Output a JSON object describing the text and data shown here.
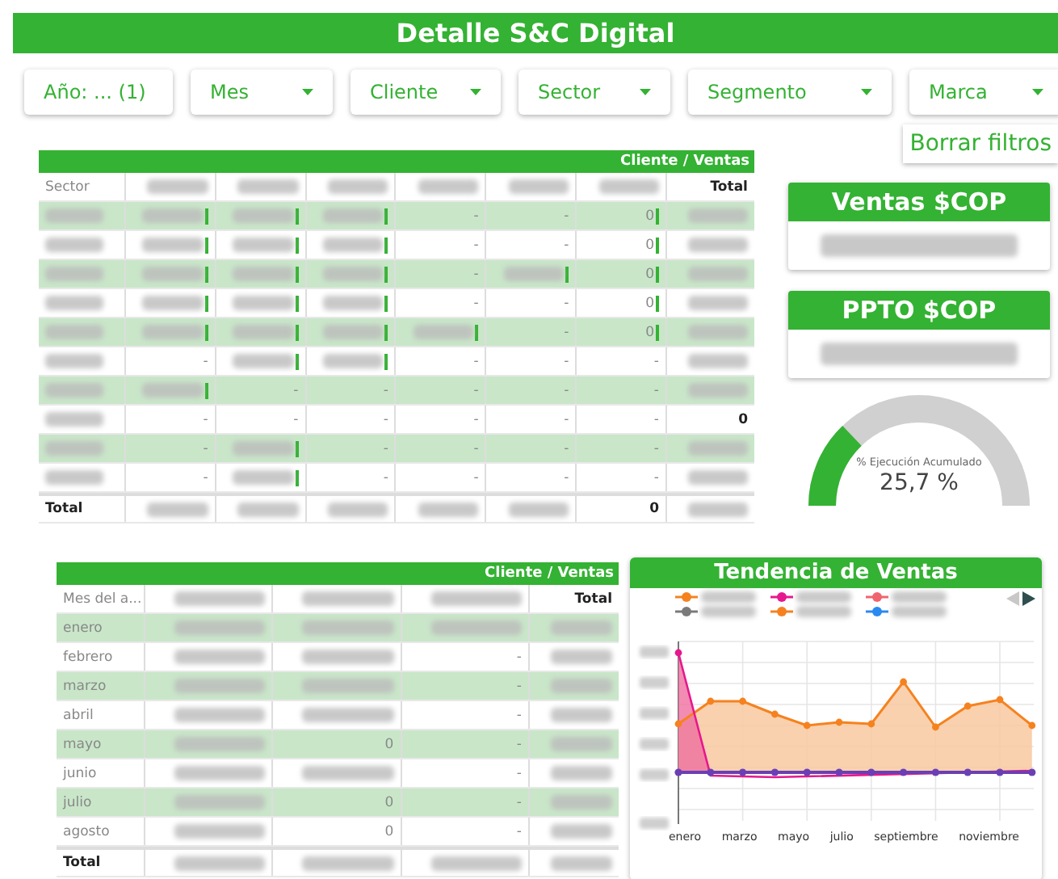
{
  "title": "Detalle S&C Digital",
  "filters": [
    {
      "label": "Año: ... (1)"
    },
    {
      "label": "Mes"
    },
    {
      "label": "Cliente"
    },
    {
      "label": "Sector"
    },
    {
      "label": "Segmento"
    },
    {
      "label": "Marca"
    }
  ],
  "clear_button": "Borrar filtros",
  "sector_table": {
    "banner": "Cliente / Ventas",
    "header": [
      {
        "kind": "text",
        "text": "Sector"
      },
      {
        "kind": "blurred"
      },
      {
        "kind": "blurred"
      },
      {
        "kind": "blurred"
      },
      {
        "kind": "blurred"
      },
      {
        "kind": "blurred"
      },
      {
        "kind": "blurred"
      },
      {
        "kind": "text",
        "text": "Total"
      }
    ],
    "rows": [
      [
        {
          "kind": "blurred"
        },
        {
          "kind": "blurred",
          "bar": true
        },
        {
          "kind": "blurred",
          "bar": true
        },
        {
          "kind": "blurred",
          "bar": true
        },
        {
          "kind": "text",
          "text": "-"
        },
        {
          "kind": "text",
          "text": "-"
        },
        {
          "kind": "text",
          "text": "0",
          "bar": true
        },
        {
          "kind": "blurred"
        }
      ],
      [
        {
          "kind": "blurred"
        },
        {
          "kind": "blurred",
          "bar": true
        },
        {
          "kind": "blurred",
          "bar": true
        },
        {
          "kind": "blurred",
          "bar": true
        },
        {
          "kind": "text",
          "text": "-"
        },
        {
          "kind": "text",
          "text": "-"
        },
        {
          "kind": "text",
          "text": "0",
          "bar": true
        },
        {
          "kind": "blurred"
        }
      ],
      [
        {
          "kind": "blurred"
        },
        {
          "kind": "blurred",
          "bar": true
        },
        {
          "kind": "blurred",
          "bar": true
        },
        {
          "kind": "blurred",
          "bar": true
        },
        {
          "kind": "text",
          "text": "-"
        },
        {
          "kind": "blurred",
          "bar": true
        },
        {
          "kind": "text",
          "text": "0",
          "bar": true
        },
        {
          "kind": "blurred"
        }
      ],
      [
        {
          "kind": "blurred"
        },
        {
          "kind": "blurred",
          "bar": true
        },
        {
          "kind": "blurred",
          "bar": true
        },
        {
          "kind": "blurred",
          "bar": true
        },
        {
          "kind": "text",
          "text": "-"
        },
        {
          "kind": "text",
          "text": "-"
        },
        {
          "kind": "text",
          "text": "0",
          "bar": true
        },
        {
          "kind": "blurred"
        }
      ],
      [
        {
          "kind": "blurred"
        },
        {
          "kind": "blurred",
          "bar": true
        },
        {
          "kind": "blurred",
          "bar": true
        },
        {
          "kind": "blurred",
          "bar": true
        },
        {
          "kind": "blurred",
          "bar": true
        },
        {
          "kind": "text",
          "text": "-"
        },
        {
          "kind": "text",
          "text": "0",
          "bar": true
        },
        {
          "kind": "blurred"
        }
      ],
      [
        {
          "kind": "blurred"
        },
        {
          "kind": "text",
          "text": "-"
        },
        {
          "kind": "blurred",
          "bar": true
        },
        {
          "kind": "blurred",
          "bar": true
        },
        {
          "kind": "text",
          "text": "-"
        },
        {
          "kind": "text",
          "text": "-"
        },
        {
          "kind": "text",
          "text": "-"
        },
        {
          "kind": "blurred"
        }
      ],
      [
        {
          "kind": "blurred"
        },
        {
          "kind": "blurred",
          "bar": true
        },
        {
          "kind": "text",
          "text": "-"
        },
        {
          "kind": "text",
          "text": "-"
        },
        {
          "kind": "text",
          "text": "-"
        },
        {
          "kind": "text",
          "text": "-"
        },
        {
          "kind": "text",
          "text": "-"
        },
        {
          "kind": "blurred"
        }
      ],
      [
        {
          "kind": "blurred"
        },
        {
          "kind": "text",
          "text": "-"
        },
        {
          "kind": "text",
          "text": "-"
        },
        {
          "kind": "text",
          "text": "-"
        },
        {
          "kind": "text",
          "text": "-"
        },
        {
          "kind": "text",
          "text": "-"
        },
        {
          "kind": "text",
          "text": "-"
        },
        {
          "kind": "text",
          "text": "0"
        }
      ],
      [
        {
          "kind": "blurred"
        },
        {
          "kind": "text",
          "text": "-"
        },
        {
          "kind": "blurred",
          "bar": true
        },
        {
          "kind": "text",
          "text": "-"
        },
        {
          "kind": "text",
          "text": "-"
        },
        {
          "kind": "text",
          "text": "-"
        },
        {
          "kind": "text",
          "text": "-"
        },
        {
          "kind": "blurred"
        }
      ],
      [
        {
          "kind": "blurred"
        },
        {
          "kind": "text",
          "text": "-"
        },
        {
          "kind": "blurred",
          "bar": true
        },
        {
          "kind": "text",
          "text": "-"
        },
        {
          "kind": "text",
          "text": "-"
        },
        {
          "kind": "text",
          "text": "-"
        },
        {
          "kind": "text",
          "text": "-"
        },
        {
          "kind": "blurred"
        }
      ]
    ],
    "total_row": [
      {
        "kind": "text",
        "text": "Total"
      },
      {
        "kind": "blurred"
      },
      {
        "kind": "blurred"
      },
      {
        "kind": "blurred"
      },
      {
        "kind": "blurred"
      },
      {
        "kind": "blurred"
      },
      {
        "kind": "text",
        "text": "0"
      },
      {
        "kind": "blurred"
      }
    ]
  },
  "kpis": [
    {
      "title": "Ventas $COP",
      "value": {
        "kind": "blurred"
      }
    },
    {
      "title": "PPTO $COP",
      "value": {
        "kind": "blurred"
      }
    }
  ],
  "gauge": {
    "label": "% Ejecución Acumulado",
    "reading": "25,7 %"
  },
  "month_table": {
    "banner": "Cliente / Ventas",
    "header": [
      {
        "kind": "text",
        "text": "Mes del a..."
      },
      {
        "kind": "blurred"
      },
      {
        "kind": "blurred"
      },
      {
        "kind": "blurred"
      },
      {
        "kind": "text",
        "text": "Total"
      }
    ],
    "rows": [
      [
        {
          "kind": "text",
          "text": "enero"
        },
        {
          "kind": "blurred"
        },
        {
          "kind": "blurred"
        },
        {
          "kind": "blurred"
        },
        {
          "kind": "blurred"
        }
      ],
      [
        {
          "kind": "text",
          "text": "febrero"
        },
        {
          "kind": "blurred"
        },
        {
          "kind": "blurred"
        },
        {
          "kind": "text",
          "text": "-"
        },
        {
          "kind": "blurred"
        }
      ],
      [
        {
          "kind": "text",
          "text": "marzo"
        },
        {
          "kind": "blurred"
        },
        {
          "kind": "blurred"
        },
        {
          "kind": "text",
          "text": "-"
        },
        {
          "kind": "blurred"
        }
      ],
      [
        {
          "kind": "text",
          "text": "abril"
        },
        {
          "kind": "blurred"
        },
        {
          "kind": "blurred"
        },
        {
          "kind": "text",
          "text": "-"
        },
        {
          "kind": "blurred"
        }
      ],
      [
        {
          "kind": "text",
          "text": "mayo"
        },
        {
          "kind": "blurred"
        },
        {
          "kind": "text",
          "text": "0"
        },
        {
          "kind": "text",
          "text": "-"
        },
        {
          "kind": "blurred"
        }
      ],
      [
        {
          "kind": "text",
          "text": "junio"
        },
        {
          "kind": "blurred"
        },
        {
          "kind": "blurred"
        },
        {
          "kind": "text",
          "text": "-"
        },
        {
          "kind": "blurred"
        }
      ],
      [
        {
          "kind": "text",
          "text": "julio"
        },
        {
          "kind": "blurred"
        },
        {
          "kind": "text",
          "text": "0"
        },
        {
          "kind": "text",
          "text": "-"
        },
        {
          "kind": "blurred"
        }
      ],
      [
        {
          "kind": "text",
          "text": "agosto"
        },
        {
          "kind": "blurred"
        },
        {
          "kind": "text",
          "text": "0"
        },
        {
          "kind": "text",
          "text": "-"
        },
        {
          "kind": "blurred"
        }
      ]
    ],
    "total_row": [
      {
        "kind": "text",
        "text": "Total"
      },
      {
        "kind": "blurred"
      },
      {
        "kind": "blurred"
      },
      {
        "kind": "blurred"
      },
      {
        "kind": "blurred"
      }
    ]
  },
  "trend_chart": {
    "title": "Tendencia de Ventas",
    "legend": [
      {
        "color": "#f5821f"
      },
      {
        "color": "#e6188e"
      },
      {
        "color": "#f0646e"
      },
      {
        "color": "#7a7a7a"
      },
      {
        "color": "#f5821f"
      },
      {
        "color": "#2a8af0"
      }
    ],
    "prev_disabled": true,
    "next_disabled": false,
    "x_labels": [
      "enero",
      "marzo",
      "mayo",
      "julio",
      "septiembre",
      "noviembre"
    ]
  }
}
